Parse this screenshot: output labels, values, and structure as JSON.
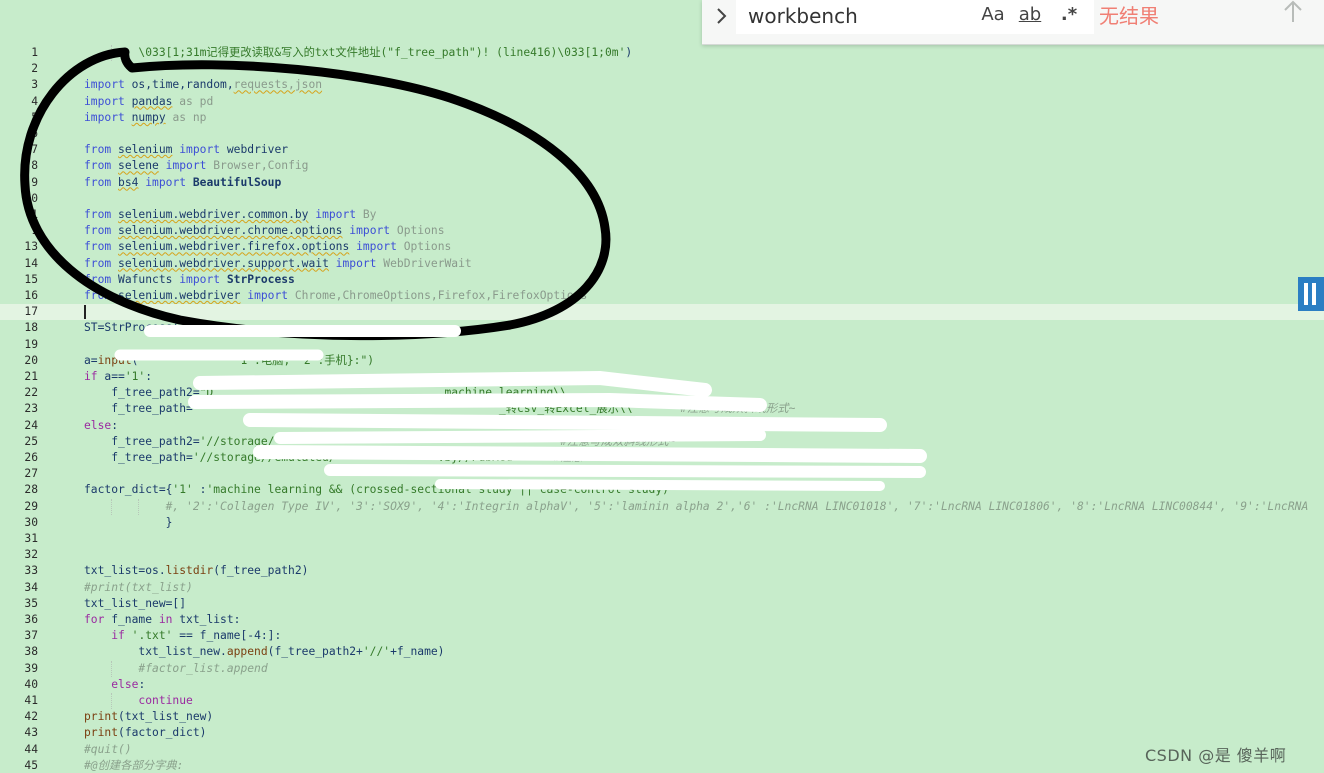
{
  "editor": {
    "current_line": 17,
    "lines": [
      {
        "n": "1",
        "spans": [
          {
            "t": "        "
          },
          {
            "t": "\\033[1;31m记得更改读取&写入的txt文件地址(\"f_tree_path\")",
            "c": "str"
          },
          {
            "t": "! ",
            "c": "str"
          },
          {
            "t": "(line416)",
            "c": "str"
          },
          {
            "t": "\\033[1;0m'",
            "c": "str"
          },
          {
            "t": ")",
            "c": ""
          }
        ]
      },
      {
        "n": "2",
        "spans": []
      },
      {
        "n": "3",
        "spans": [
          {
            "t": "import",
            "c": "kw"
          },
          {
            "t": " os,time,random,"
          },
          {
            "t": "requests,json",
            "c": "dim sq"
          }
        ]
      },
      {
        "n": "4",
        "spans": [
          {
            "t": "import",
            "c": "kw"
          },
          {
            "t": " "
          },
          {
            "t": "pandas",
            "c": "sq"
          },
          {
            "t": " as pd",
            "c": "dim"
          }
        ]
      },
      {
        "n": "5",
        "spans": [
          {
            "t": "import",
            "c": "kw"
          },
          {
            "t": " "
          },
          {
            "t": "numpy",
            "c": "sq"
          },
          {
            "t": " as np",
            "c": "dim"
          }
        ]
      },
      {
        "n": "6",
        "spans": []
      },
      {
        "n": "7",
        "spans": [
          {
            "t": "from",
            "c": "kw"
          },
          {
            "t": " "
          },
          {
            "t": "selenium",
            "c": "sq"
          },
          {
            "t": " import",
            "c": "kw"
          },
          {
            "t": " webdriver"
          }
        ]
      },
      {
        "n": "8",
        "spans": [
          {
            "t": "from",
            "c": "kw"
          },
          {
            "t": " "
          },
          {
            "t": "selene",
            "c": "sq"
          },
          {
            "t": " import",
            "c": "kw"
          },
          {
            "t": " Browser,Config",
            "c": "dim"
          }
        ]
      },
      {
        "n": "9",
        "spans": [
          {
            "t": "from",
            "c": "kw"
          },
          {
            "t": " "
          },
          {
            "t": "bs4",
            "c": "sq"
          },
          {
            "t": " import",
            "c": "kw"
          },
          {
            "t": " BeautifulSoup",
            "c": "bold"
          }
        ]
      },
      {
        "n": "0",
        "spans": []
      },
      {
        "n": "1",
        "spans": [
          {
            "t": "from",
            "c": "kw"
          },
          {
            "t": " "
          },
          {
            "t": "selenium.webdriver.common.by",
            "c": "sq"
          },
          {
            "t": " import",
            "c": "kw"
          },
          {
            "t": " By",
            "c": "dim"
          }
        ]
      },
      {
        "n": "1",
        "spans": [
          {
            "t": "from",
            "c": "kw"
          },
          {
            "t": " "
          },
          {
            "t": "selenium.webdriver.chrome.options",
            "c": "sq"
          },
          {
            "t": " import",
            "c": "kw"
          },
          {
            "t": " Options",
            "c": "dim"
          }
        ]
      },
      {
        "n": "13",
        "spans": [
          {
            "t": "from",
            "c": "kw"
          },
          {
            "t": " "
          },
          {
            "t": "selenium.webdriver.firefox.options",
            "c": "sq"
          },
          {
            "t": " import",
            "c": "kw"
          },
          {
            "t": " Options",
            "c": "dim"
          }
        ]
      },
      {
        "n": "14",
        "spans": [
          {
            "t": "from",
            "c": "kw"
          },
          {
            "t": " "
          },
          {
            "t": "selenium.webdriver.support.wait",
            "c": "sq"
          },
          {
            "t": " import",
            "c": "kw"
          },
          {
            "t": " WebDriverWait",
            "c": "dim"
          }
        ]
      },
      {
        "n": "15",
        "spans": [
          {
            "t": "from",
            "c": "kw"
          },
          {
            "t": " Wafuncts "
          },
          {
            "t": "import",
            "c": "kw"
          },
          {
            "t": " StrProcess",
            "c": "bold"
          }
        ]
      },
      {
        "n": "16",
        "spans": [
          {
            "t": "from",
            "c": "kw"
          },
          {
            "t": " "
          },
          {
            "t": "selenium.webdriver",
            "c": "sq"
          },
          {
            "t": " import",
            "c": "kw"
          },
          {
            "t": " Chrome,ChromeOptions,Firefox,FirefoxOptions",
            "c": "dim"
          }
        ]
      },
      {
        "n": "17",
        "spans": []
      },
      {
        "n": "18",
        "spans": [
          {
            "t": "ST=StrProcess("
          }
        ]
      },
      {
        "n": "19",
        "spans": []
      },
      {
        "n": "20",
        "spans": [
          {
            "t": "a="
          },
          {
            "t": "input",
            "c": "fn"
          },
          {
            "t": "(              "
          },
          {
            "t": "'1':电脑, '2':手机}",
            "c": "str"
          },
          {
            "t": ":",
            "c": "str"
          },
          {
            "t": "\")",
            "c": "str"
          }
        ]
      },
      {
        "n": "21",
        "spans": [
          {
            "t": "if",
            "c": "ctl"
          },
          {
            "t": " a=="
          },
          {
            "t": "'1'",
            "c": "str"
          },
          {
            "t": ":"
          }
        ]
      },
      {
        "n": "22",
        "spans": [
          {
            "t": "    f_tree_path2="
          },
          {
            "t": "\"D",
            "c": "str"
          },
          {
            "t": "                                  "
          },
          {
            "t": "machine learning\\\\",
            "c": "str"
          }
        ]
      },
      {
        "n": "23",
        "spans": [
          {
            "t": "    f_tree_path="
          },
          {
            "t": "\"",
            "c": "str"
          },
          {
            "t": "                                            "
          },
          {
            "t": "_转csv_转Excel_展示\\\\\"",
            "c": "str"
          },
          {
            "t": "      "
          },
          {
            "t": "#注意写成双斜线形式~",
            "c": "cm"
          }
        ]
      },
      {
        "n": "24",
        "spans": [
          {
            "t": "else",
            "c": "ctl"
          },
          {
            "t": ":"
          }
        ]
      },
      {
        "n": "25",
        "spans": [
          {
            "t": "    f_tree_path2="
          },
          {
            "t": "'//storage/",
            "c": "str"
          },
          {
            "t": "                                          "
          },
          {
            "t": "#注意写成双斜线形式~",
            "c": "cm"
          }
        ]
      },
      {
        "n": "26",
        "spans": [
          {
            "t": "    f_tree_path="
          },
          {
            "t": "'//storage//emulated/",
            "c": "str"
          },
          {
            "t": "               "
          },
          {
            "t": ".by//PubMed'",
            "c": "str"
          },
          {
            "t": "     "
          },
          {
            "t": "#注意",
            "c": "cm"
          }
        ]
      },
      {
        "n": "27",
        "spans": []
      },
      {
        "n": "28",
        "spans": [
          {
            "t": "factor_dict={"
          },
          {
            "t": "'1'",
            "c": "str"
          },
          {
            "t": " :"
          },
          {
            "t": "'machine learning && (crossed-sectional study || case-control study)",
            "c": "str"
          }
        ]
      },
      {
        "n": "29",
        "spans": [
          {
            "t": "            "
          },
          {
            "t": "#, '2':'Collagen Type IV', '3':'SOX9', '4':'Integrin alphaV', '5':'laminin alpha 2','6' :'LncRNA LINC01018', '7':'LncRNA LINC01806', '8':'LncRNA LINC00844', '9':'LncRNA",
            "c": "cm"
          }
        ]
      },
      {
        "n": "30",
        "spans": [
          {
            "t": "            }"
          }
        ]
      },
      {
        "n": "31",
        "spans": []
      },
      {
        "n": "32",
        "spans": []
      },
      {
        "n": "33",
        "spans": [
          {
            "t": "txt_list=os."
          },
          {
            "t": "listdir",
            "c": "fn"
          },
          {
            "t": "(f_tree_path2)"
          }
        ]
      },
      {
        "n": "34",
        "spans": [
          {
            "t": "#print(txt_list)",
            "c": "cm"
          }
        ]
      },
      {
        "n": "35",
        "spans": [
          {
            "t": "txt_list_new=[]"
          }
        ]
      },
      {
        "n": "36",
        "spans": [
          {
            "t": "for",
            "c": "ctl"
          },
          {
            "t": " f_name "
          },
          {
            "t": "in",
            "c": "ctl"
          },
          {
            "t": " txt_list:"
          }
        ]
      },
      {
        "n": "37",
        "spans": [
          {
            "t": "    "
          },
          {
            "t": "if",
            "c": "ctl"
          },
          {
            "t": " "
          },
          {
            "t": "'.txt'",
            "c": "str"
          },
          {
            "t": " == f_name[-4:]:"
          }
        ]
      },
      {
        "n": "38",
        "spans": [
          {
            "t": "        txt_list_new."
          },
          {
            "t": "append",
            "c": "fn"
          },
          {
            "t": "(f_tree_path2+"
          },
          {
            "t": "'//'",
            "c": "str"
          },
          {
            "t": "+f_name)"
          }
        ]
      },
      {
        "n": "39",
        "spans": [
          {
            "t": "        "
          },
          {
            "t": "#factor_list.append",
            "c": "cm"
          }
        ]
      },
      {
        "n": "40",
        "spans": [
          {
            "t": "    "
          },
          {
            "t": "else",
            "c": "ctl"
          },
          {
            "t": ":"
          }
        ]
      },
      {
        "n": "41",
        "spans": [
          {
            "t": "        "
          },
          {
            "t": "continue",
            "c": "ctl"
          }
        ]
      },
      {
        "n": "42",
        "spans": [
          {
            "t": "print",
            "c": "fn"
          },
          {
            "t": "(txt_list_new)"
          }
        ]
      },
      {
        "n": "43",
        "spans": [
          {
            "t": "print",
            "c": "fn"
          },
          {
            "t": "(factor_dict)"
          }
        ]
      },
      {
        "n": "44",
        "spans": [
          {
            "t": "#quit()",
            "c": "cm"
          }
        ]
      },
      {
        "n": "45",
        "spans": [
          {
            "t": "#@创建各部分字典:",
            "c": "cm"
          }
        ]
      }
    ]
  },
  "find_widget": {
    "query": "workbench",
    "match_case_label": "Aa",
    "whole_word_label": "ab",
    "regex_label": ".*",
    "result_text": "无结果",
    "expand_icon": "chevron-right-icon",
    "prev_icon": "arrow-up-icon"
  },
  "watermark": "CSDN @是  傻羊啊"
}
